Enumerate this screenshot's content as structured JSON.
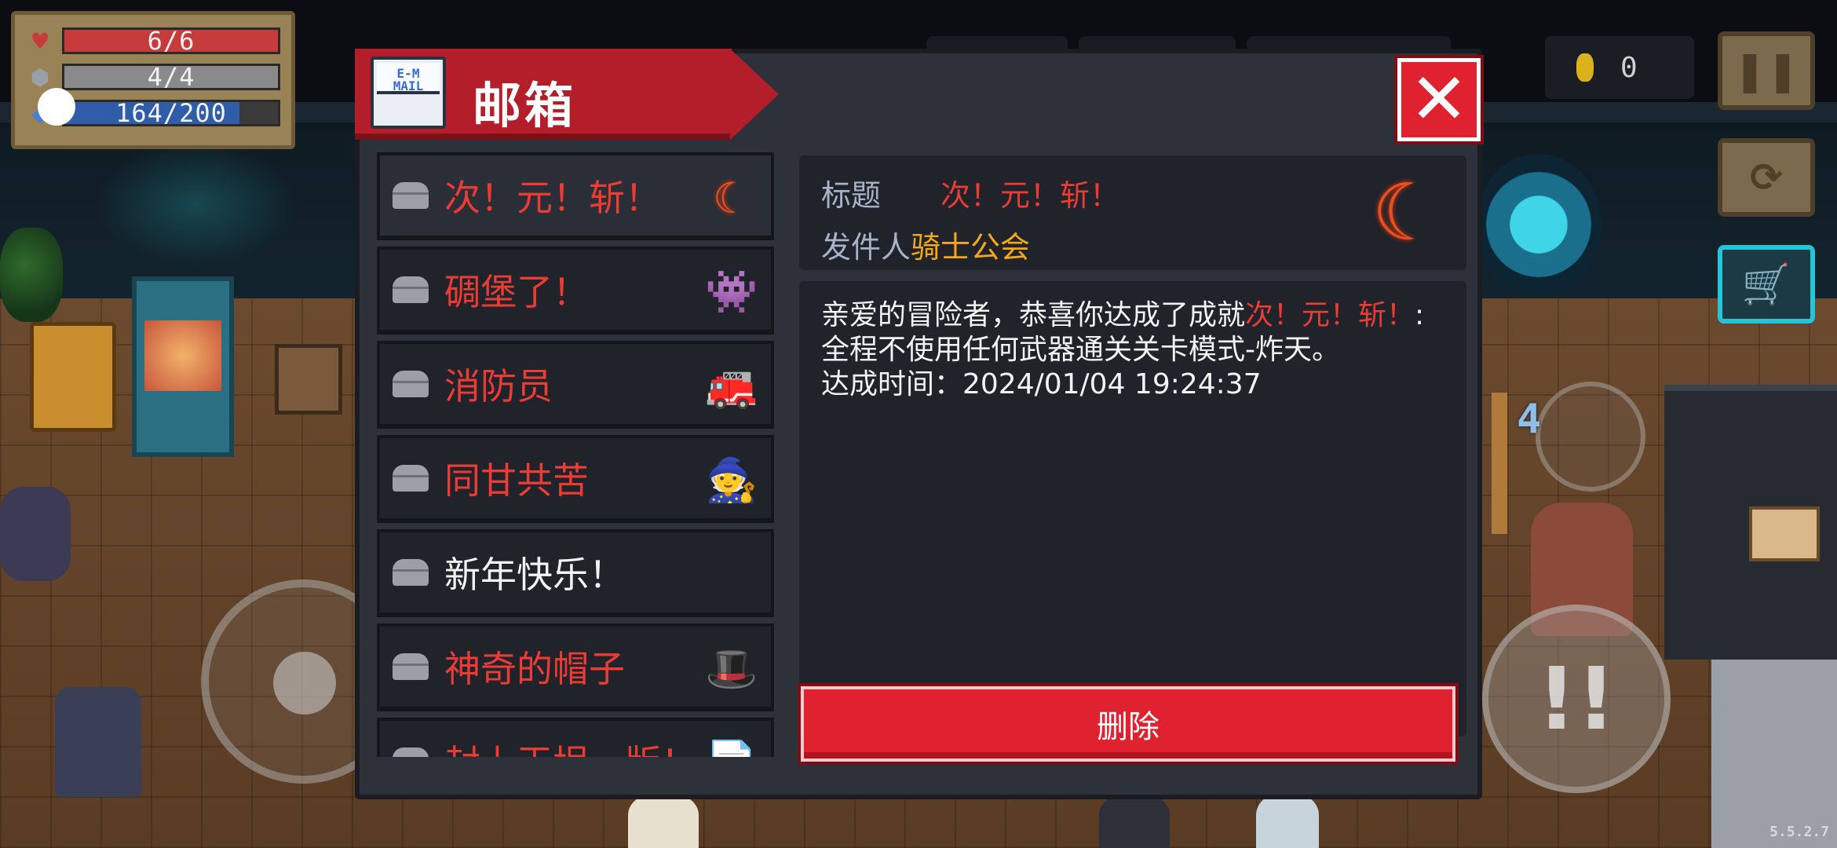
{
  "hud": {
    "health": {
      "label": "6/6",
      "fraction": 1.0,
      "color": "#c63b3b"
    },
    "armor": {
      "label": "4/4",
      "fraction": 1.0,
      "color": "#8a8a8a"
    },
    "energy": {
      "label": "164/200",
      "fraction": 0.82,
      "color": "#2f5da8"
    },
    "coins": "0"
  },
  "mailbox": {
    "title": "邮箱",
    "envelope_text": "E-M\nMAIL",
    "close_label": "✕",
    "mails": [
      {
        "title": "次！元！斩！",
        "read": false,
        "icon": "crescent-blade-icon",
        "glyph": "☾"
      },
      {
        "title": "碉堡了！",
        "read": false,
        "icon": "purple-ghost-icon",
        "glyph": "👾"
      },
      {
        "title": "消防员",
        "read": false,
        "icon": "fire-hose-icon",
        "glyph": "🚒"
      },
      {
        "title": "同甘共苦",
        "read": false,
        "icon": "companions-icon",
        "glyph": "🧙"
      },
      {
        "title": "新年快乐！",
        "read": true,
        "icon": "",
        "glyph": ""
      },
      {
        "title": "神奇的帽子",
        "read": false,
        "icon": "magic-hat-icon",
        "glyph": "🎩"
      },
      {
        "title": "封上王埕一版！",
        "read": false,
        "icon": "document-icon",
        "glyph": "📄"
      }
    ],
    "detail": {
      "title_label": "标题",
      "title_value": "次！元！斩！",
      "sender_label": "发件人",
      "sender_value": "骑士公会",
      "body_prefix": "亲爱的冒险者，恭喜你达成了成就",
      "body_highlight": "次！元！斩！",
      "body_suffix": ":全程不使用任何武器通关关卡模式-炸天。",
      "achieved_line": "达成时间：2024/01/04 19:24:37",
      "icon": "crescent-blade-icon"
    },
    "delete_label": "删除"
  },
  "version": "5.5.2.7",
  "skill_count": "4",
  "colors": {
    "accent_red": "#e02130",
    "highlight_red": "#ea3b35",
    "sender_gold": "#f3a81b",
    "panel": "#2d3139",
    "panel_dark": "#20232a"
  }
}
